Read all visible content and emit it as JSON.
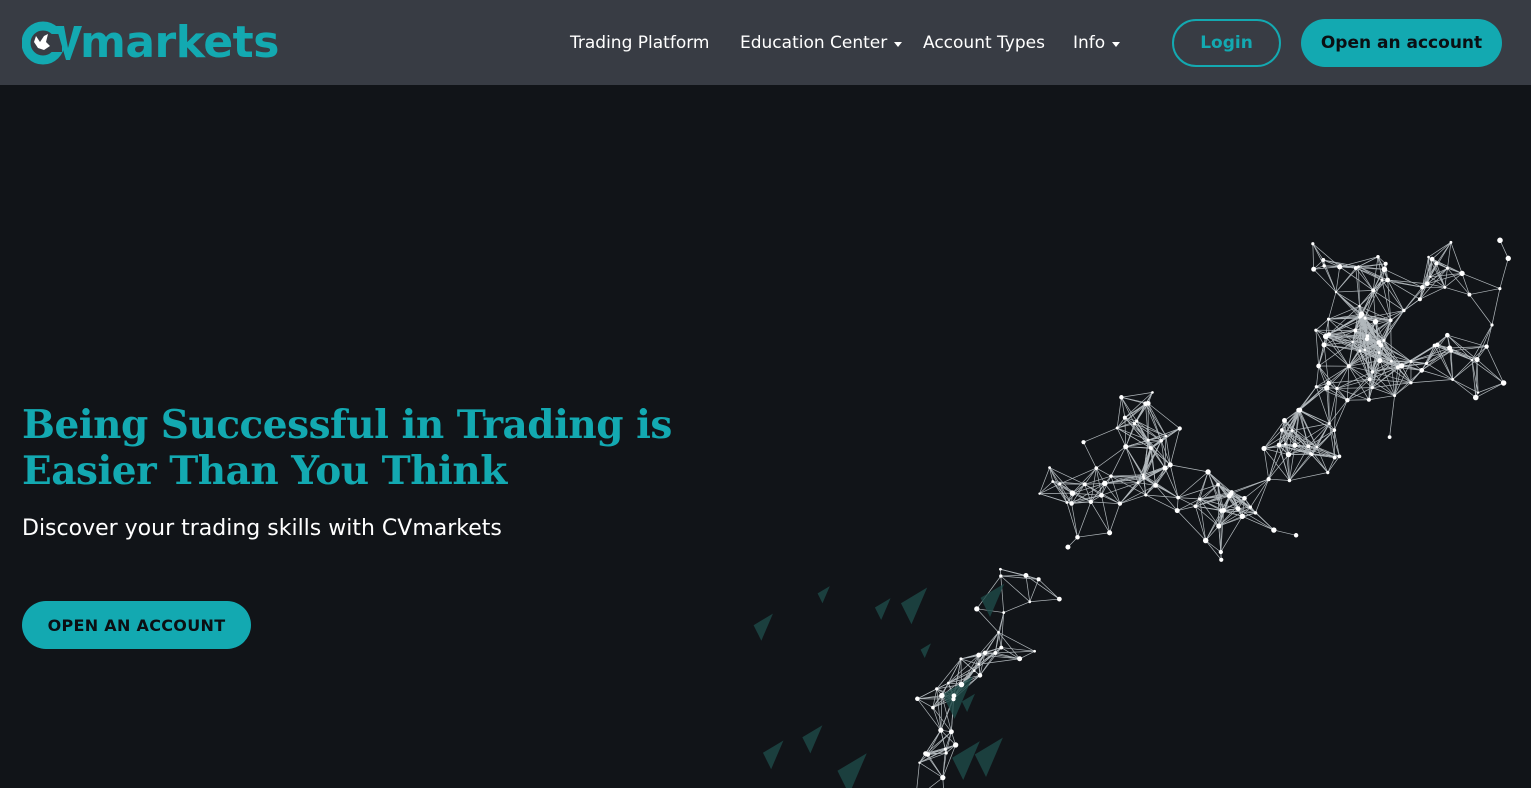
{
  "brand": {
    "logo_text": "markets",
    "logo_icon": "bull-c-logo-icon",
    "accent_color": "#13a9b1",
    "nav_background": "#383c44",
    "page_background": "#111418"
  },
  "nav": {
    "items": [
      {
        "label": "Trading Platform",
        "dropdown": false
      },
      {
        "label": "Education Center",
        "dropdown": true
      },
      {
        "label": "Account Types",
        "dropdown": false
      },
      {
        "label": "Info",
        "dropdown": true
      }
    ],
    "login_label": "Login",
    "open_account_label": "Open an account"
  },
  "hero": {
    "title_line1": "Being Successful in Trading is",
    "title_line2": "Easier Than You Think",
    "subtitle": "Discover your trading skills with CVmarkets",
    "cta_label": "OPEN AN ACCOUNT",
    "graphic": "rising-arrow-network-illustration"
  }
}
